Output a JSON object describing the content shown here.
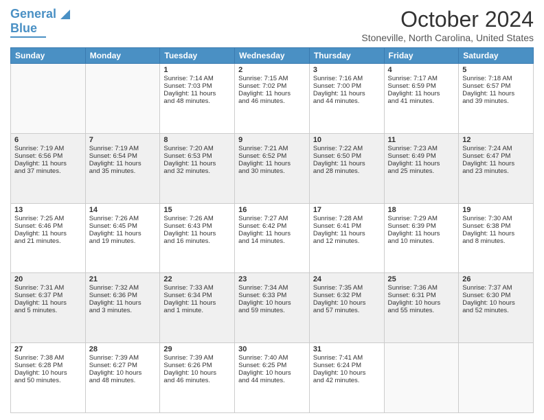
{
  "logo": {
    "text1": "General",
    "text2": "Blue"
  },
  "title": "October 2024",
  "location": "Stoneville, North Carolina, United States",
  "weekdays": [
    "Sunday",
    "Monday",
    "Tuesday",
    "Wednesday",
    "Thursday",
    "Friday",
    "Saturday"
  ],
  "weeks": [
    [
      {
        "day": "",
        "lines": []
      },
      {
        "day": "",
        "lines": []
      },
      {
        "day": "1",
        "lines": [
          "Sunrise: 7:14 AM",
          "Sunset: 7:03 PM",
          "Daylight: 11 hours",
          "and 48 minutes."
        ]
      },
      {
        "day": "2",
        "lines": [
          "Sunrise: 7:15 AM",
          "Sunset: 7:02 PM",
          "Daylight: 11 hours",
          "and 46 minutes."
        ]
      },
      {
        "day": "3",
        "lines": [
          "Sunrise: 7:16 AM",
          "Sunset: 7:00 PM",
          "Daylight: 11 hours",
          "and 44 minutes."
        ]
      },
      {
        "day": "4",
        "lines": [
          "Sunrise: 7:17 AM",
          "Sunset: 6:59 PM",
          "Daylight: 11 hours",
          "and 41 minutes."
        ]
      },
      {
        "day": "5",
        "lines": [
          "Sunrise: 7:18 AM",
          "Sunset: 6:57 PM",
          "Daylight: 11 hours",
          "and 39 minutes."
        ]
      }
    ],
    [
      {
        "day": "6",
        "lines": [
          "Sunrise: 7:19 AM",
          "Sunset: 6:56 PM",
          "Daylight: 11 hours",
          "and 37 minutes."
        ]
      },
      {
        "day": "7",
        "lines": [
          "Sunrise: 7:19 AM",
          "Sunset: 6:54 PM",
          "Daylight: 11 hours",
          "and 35 minutes."
        ]
      },
      {
        "day": "8",
        "lines": [
          "Sunrise: 7:20 AM",
          "Sunset: 6:53 PM",
          "Daylight: 11 hours",
          "and 32 minutes."
        ]
      },
      {
        "day": "9",
        "lines": [
          "Sunrise: 7:21 AM",
          "Sunset: 6:52 PM",
          "Daylight: 11 hours",
          "and 30 minutes."
        ]
      },
      {
        "day": "10",
        "lines": [
          "Sunrise: 7:22 AM",
          "Sunset: 6:50 PM",
          "Daylight: 11 hours",
          "and 28 minutes."
        ]
      },
      {
        "day": "11",
        "lines": [
          "Sunrise: 7:23 AM",
          "Sunset: 6:49 PM",
          "Daylight: 11 hours",
          "and 25 minutes."
        ]
      },
      {
        "day": "12",
        "lines": [
          "Sunrise: 7:24 AM",
          "Sunset: 6:47 PM",
          "Daylight: 11 hours",
          "and 23 minutes."
        ]
      }
    ],
    [
      {
        "day": "13",
        "lines": [
          "Sunrise: 7:25 AM",
          "Sunset: 6:46 PM",
          "Daylight: 11 hours",
          "and 21 minutes."
        ]
      },
      {
        "day": "14",
        "lines": [
          "Sunrise: 7:26 AM",
          "Sunset: 6:45 PM",
          "Daylight: 11 hours",
          "and 19 minutes."
        ]
      },
      {
        "day": "15",
        "lines": [
          "Sunrise: 7:26 AM",
          "Sunset: 6:43 PM",
          "Daylight: 11 hours",
          "and 16 minutes."
        ]
      },
      {
        "day": "16",
        "lines": [
          "Sunrise: 7:27 AM",
          "Sunset: 6:42 PM",
          "Daylight: 11 hours",
          "and 14 minutes."
        ]
      },
      {
        "day": "17",
        "lines": [
          "Sunrise: 7:28 AM",
          "Sunset: 6:41 PM",
          "Daylight: 11 hours",
          "and 12 minutes."
        ]
      },
      {
        "day": "18",
        "lines": [
          "Sunrise: 7:29 AM",
          "Sunset: 6:39 PM",
          "Daylight: 11 hours",
          "and 10 minutes."
        ]
      },
      {
        "day": "19",
        "lines": [
          "Sunrise: 7:30 AM",
          "Sunset: 6:38 PM",
          "Daylight: 11 hours",
          "and 8 minutes."
        ]
      }
    ],
    [
      {
        "day": "20",
        "lines": [
          "Sunrise: 7:31 AM",
          "Sunset: 6:37 PM",
          "Daylight: 11 hours",
          "and 5 minutes."
        ]
      },
      {
        "day": "21",
        "lines": [
          "Sunrise: 7:32 AM",
          "Sunset: 6:36 PM",
          "Daylight: 11 hours",
          "and 3 minutes."
        ]
      },
      {
        "day": "22",
        "lines": [
          "Sunrise: 7:33 AM",
          "Sunset: 6:34 PM",
          "Daylight: 11 hours",
          "and 1 minute."
        ]
      },
      {
        "day": "23",
        "lines": [
          "Sunrise: 7:34 AM",
          "Sunset: 6:33 PM",
          "Daylight: 10 hours",
          "and 59 minutes."
        ]
      },
      {
        "day": "24",
        "lines": [
          "Sunrise: 7:35 AM",
          "Sunset: 6:32 PM",
          "Daylight: 10 hours",
          "and 57 minutes."
        ]
      },
      {
        "day": "25",
        "lines": [
          "Sunrise: 7:36 AM",
          "Sunset: 6:31 PM",
          "Daylight: 10 hours",
          "and 55 minutes."
        ]
      },
      {
        "day": "26",
        "lines": [
          "Sunrise: 7:37 AM",
          "Sunset: 6:30 PM",
          "Daylight: 10 hours",
          "and 52 minutes."
        ]
      }
    ],
    [
      {
        "day": "27",
        "lines": [
          "Sunrise: 7:38 AM",
          "Sunset: 6:28 PM",
          "Daylight: 10 hours",
          "and 50 minutes."
        ]
      },
      {
        "day": "28",
        "lines": [
          "Sunrise: 7:39 AM",
          "Sunset: 6:27 PM",
          "Daylight: 10 hours",
          "and 48 minutes."
        ]
      },
      {
        "day": "29",
        "lines": [
          "Sunrise: 7:39 AM",
          "Sunset: 6:26 PM",
          "Daylight: 10 hours",
          "and 46 minutes."
        ]
      },
      {
        "day": "30",
        "lines": [
          "Sunrise: 7:40 AM",
          "Sunset: 6:25 PM",
          "Daylight: 10 hours",
          "and 44 minutes."
        ]
      },
      {
        "day": "31",
        "lines": [
          "Sunrise: 7:41 AM",
          "Sunset: 6:24 PM",
          "Daylight: 10 hours",
          "and 42 minutes."
        ]
      },
      {
        "day": "",
        "lines": []
      },
      {
        "day": "",
        "lines": []
      }
    ]
  ]
}
